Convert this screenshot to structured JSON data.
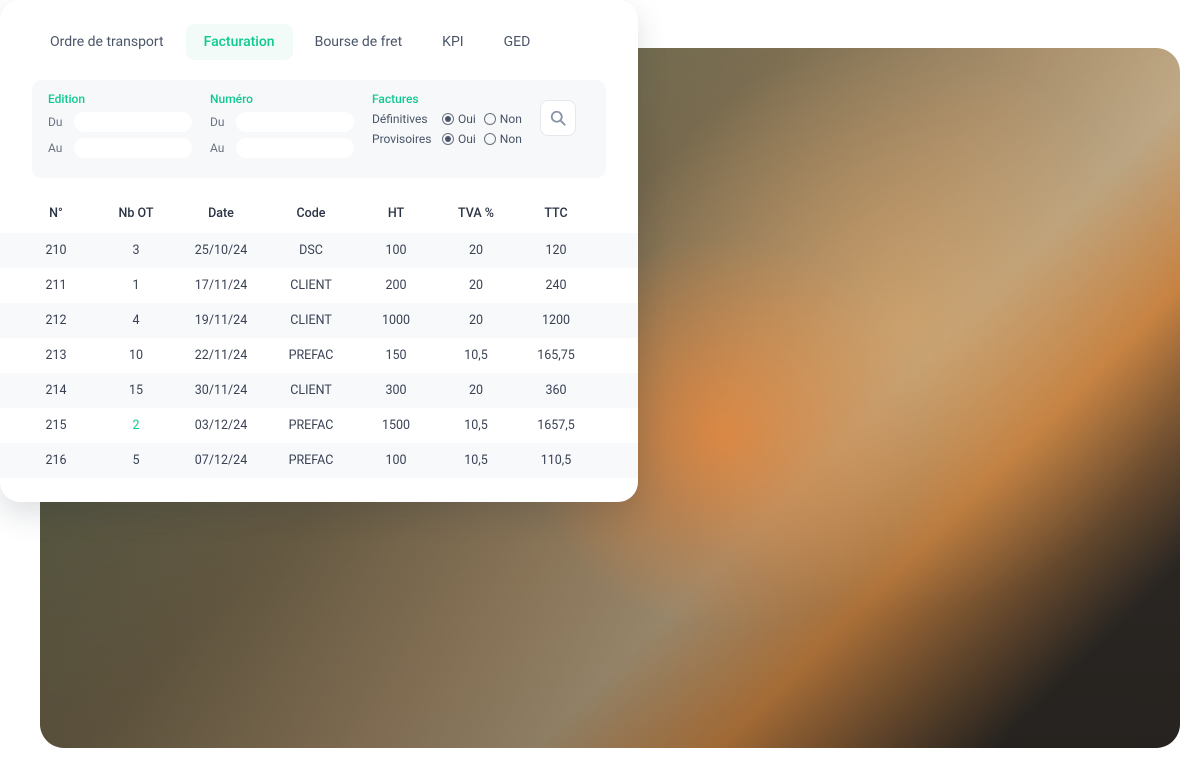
{
  "tabs": [
    {
      "label": "Ordre de transport",
      "active": false
    },
    {
      "label": "Facturation",
      "active": true
    },
    {
      "label": "Bourse de fret",
      "active": false
    },
    {
      "label": "KPI",
      "active": false
    },
    {
      "label": "GED",
      "active": false
    }
  ],
  "filters": {
    "edition": {
      "title": "Edition",
      "du_label": "Du",
      "au_label": "Au",
      "du_value": "",
      "au_value": ""
    },
    "numero": {
      "title": "Numéro",
      "du_label": "Du",
      "au_label": "Au",
      "du_value": "",
      "au_value": ""
    },
    "factures": {
      "title": "Factures",
      "rows": [
        {
          "label": "Définitives",
          "oui": "Oui",
          "non": "Non",
          "value": "Oui"
        },
        {
          "label": "Provisoires",
          "oui": "Oui",
          "non": "Non",
          "value": "Oui"
        }
      ]
    }
  },
  "table": {
    "headers": [
      "N°",
      "Nb OT",
      "Date",
      "Code",
      "HT",
      "TVA %",
      "TTC"
    ],
    "rows": [
      {
        "num": "210",
        "nb_ot": "3",
        "date": "25/10/24",
        "code": "DSC",
        "ht": "100",
        "tva": "20",
        "ttc": "120",
        "link": false
      },
      {
        "num": "211",
        "nb_ot": "1",
        "date": "17/11/24",
        "code": "CLIENT",
        "ht": "200",
        "tva": "20",
        "ttc": "240",
        "link": false
      },
      {
        "num": "212",
        "nb_ot": "4",
        "date": "19/11/24",
        "code": "CLIENT",
        "ht": "1000",
        "tva": "20",
        "ttc": "1200",
        "link": false
      },
      {
        "num": "213",
        "nb_ot": "10",
        "date": "22/11/24",
        "code": "PREFAC",
        "ht": "150",
        "tva": "10,5",
        "ttc": "165,75",
        "link": false
      },
      {
        "num": "214",
        "nb_ot": "15",
        "date": "30/11/24",
        "code": "CLIENT",
        "ht": "300",
        "tva": "20",
        "ttc": "360",
        "link": false
      },
      {
        "num": "215",
        "nb_ot": "2",
        "date": "03/12/24",
        "code": "PREFAC",
        "ht": "1500",
        "tva": "10,5",
        "ttc": "1657,5",
        "link": true
      },
      {
        "num": "216",
        "nb_ot": "5",
        "date": "07/12/24",
        "code": "PREFAC",
        "ht": "100",
        "tva": "10,5",
        "ttc": "110,5",
        "link": false
      }
    ]
  }
}
